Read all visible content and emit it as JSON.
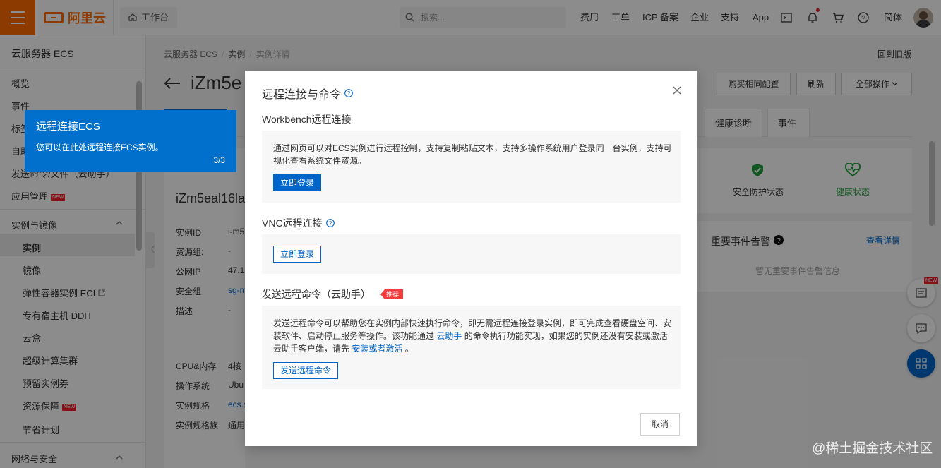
{
  "topbar": {
    "logo": "阿里云",
    "workbench": "工作台",
    "search_placeholder": "搜索...",
    "nav": [
      "费用",
      "工单",
      "ICP 备案",
      "企业",
      "支持",
      "App"
    ],
    "lang": "简体"
  },
  "sidebar": {
    "title": "云服务器 ECS",
    "items_top": [
      "概览",
      "事件",
      "标签",
      "自助",
      "发送命令/文件（云助手）",
      "应用管理"
    ],
    "new_badge": "NEW",
    "group_instances": "实例与镜像",
    "sub_items": [
      "实例",
      "镜像",
      "弹性容器实例 ECI",
      "专有宿主机 DDH",
      "云盒",
      "超级计算集群",
      "预留实例券",
      "资源保障",
      "节省计划"
    ],
    "group_network": "网络与安全"
  },
  "main": {
    "breadcrumb": [
      "云服务器 ECS",
      "实例",
      "实例详情"
    ],
    "back_old": "回到旧版",
    "title": "iZm5e",
    "buttons": [
      "购买相同配置",
      "刷新",
      "全部操作"
    ],
    "tabs_right": [
      "健康诊断",
      "事件"
    ],
    "instance_name": "iZm5eal16la",
    "info_labels": [
      "实例ID",
      "资源组:",
      "公网IP",
      "安全组",
      "描述"
    ],
    "info_values": [
      "i-m5",
      "-",
      "47.1",
      "sg-m",
      "-"
    ],
    "spec_labels": [
      "CPU&内存",
      "操作系统",
      "实例规格",
      "实例规格族"
    ],
    "spec_values": [
      "4核",
      "Ubu",
      "ecs.s",
      "通用"
    ],
    "status_security": "安全防护状态",
    "status_health": "健康状态",
    "events_title": "重要事件告警",
    "events_link": "查看详情",
    "events_empty": "暂无重要事件告警信息",
    "collapse_glyph": "〈"
  },
  "tour": {
    "title": "远程连接ECS",
    "desc": "您可以在此处远程连接ECS实例。",
    "step": "3/3"
  },
  "modal": {
    "title": "远程连接与命令",
    "sec1_title": "Workbench远程连接",
    "sec1_text": "通过网页可以对ECS实例进行远程控制，支持复制粘贴文本，支持多操作系统用户登录同一台实例，支持可视化查看系统文件资源。",
    "sec1_btn": "立即登录",
    "sec2_title": "VNC远程连接",
    "sec2_btn": "立即登录",
    "sec3_title": "发送远程命令（云助手）",
    "sec3_tag": "推荐",
    "sec3_text_a": "发送远程命令可以帮助您在实例内部快速执行命令，即无需远程连接登录实例，即可完成查看硬盘空间、安装软件、启动停止服务等操作。该功能通过",
    "sec3_link1": "云助手",
    "sec3_text_b": "的命令执行功能实现，如果您的实例还没有安装或激活云助手客户端，请先",
    "sec3_link2": "安装或者激活",
    "sec3_text_c": "。",
    "sec3_btn": "发送远程命令",
    "cancel": "取消"
  },
  "watermark": "@稀土掘金技术社区",
  "colors": {
    "brand": "#ff6a00",
    "primary": "#0064c8",
    "tour": "#0070cc",
    "health": "#1e9e3e"
  }
}
